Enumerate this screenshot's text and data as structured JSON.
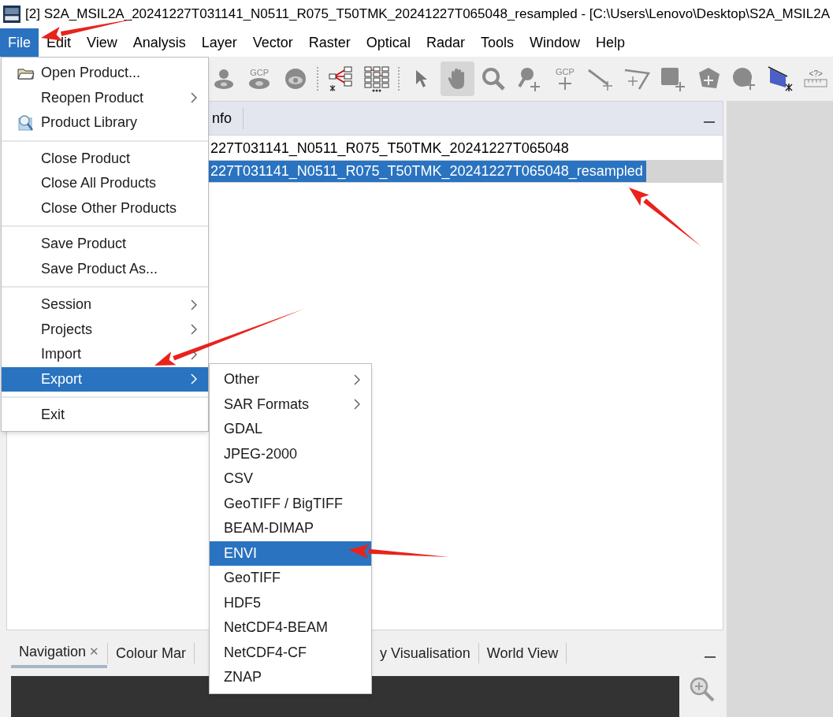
{
  "window": {
    "title": "[2] S2A_MSIL2A_20241227T031141_N0511_R075_T50TMK_20241227T065048_resampled - [C:\\Users\\Lenovo\\Desktop\\S2A_MSIL2A"
  },
  "menubar": [
    {
      "label": "File",
      "selected": true
    },
    {
      "label": "Edit",
      "selected": false
    },
    {
      "label": "View",
      "selected": false
    },
    {
      "label": "Analysis",
      "selected": false
    },
    {
      "label": "Layer",
      "selected": false
    },
    {
      "label": "Vector",
      "selected": false
    },
    {
      "label": "Raster",
      "selected": false
    },
    {
      "label": "Optical",
      "selected": false
    },
    {
      "label": "Radar",
      "selected": false
    },
    {
      "label": "Tools",
      "selected": false
    },
    {
      "label": "Window",
      "selected": false
    },
    {
      "label": "Help",
      "selected": false
    }
  ],
  "toolbar": [
    {
      "kind": "person-eye",
      "selected": false
    },
    {
      "kind": "gcp-eye",
      "label": "GCP",
      "selected": false
    },
    {
      "kind": "eye-ball",
      "selected": false
    },
    {
      "kind": "separator"
    },
    {
      "kind": "tree",
      "selected": false
    },
    {
      "kind": "grid",
      "selected": false
    },
    {
      "kind": "separator"
    },
    {
      "kind": "pointer",
      "selected": false
    },
    {
      "kind": "hand",
      "selected": true
    },
    {
      "kind": "zoom",
      "selected": false
    },
    {
      "kind": "pin-plus",
      "selected": false
    },
    {
      "kind": "gcp-plus",
      "label": "GCP",
      "selected": false
    },
    {
      "kind": "line",
      "selected": false
    },
    {
      "kind": "polyline",
      "selected": false
    },
    {
      "kind": "square-plus",
      "selected": false
    },
    {
      "kind": "shape-plus",
      "selected": false
    },
    {
      "kind": "circle-plus",
      "selected": false
    },
    {
      "kind": "select",
      "selected": false
    },
    {
      "kind": "ruler",
      "label": "<?>",
      "selected": false
    }
  ],
  "product_panel": {
    "tab": "nfo",
    "rows": [
      {
        "text": "227T031141_N0511_R075_T50TMK_20241227T065048",
        "selected": false
      },
      {
        "text": "227T031141_N0511_R075_T50TMK_20241227T065048_resampled",
        "selected": true
      }
    ]
  },
  "bottom_tabs": [
    {
      "label": "Navigation",
      "close": "✕",
      "selected": true
    },
    {
      "label": "Colour Mar",
      "selected": false
    },
    {
      "label": "y Visualisation",
      "selected": false
    },
    {
      "label": "World View",
      "selected": false
    }
  ],
  "file_menu": [
    [
      {
        "label": "Open Product...",
        "kind": "folder",
        "submenu": false,
        "selected": false
      },
      {
        "label": "Reopen Product",
        "submenu": true,
        "selected": false
      },
      {
        "label": "Product Library",
        "kind": "library",
        "submenu": false,
        "selected": false
      }
    ],
    [
      {
        "label": "Close Product",
        "submenu": false,
        "selected": false
      },
      {
        "label": "Close All Products",
        "submenu": false,
        "selected": false
      },
      {
        "label": "Close Other Products",
        "submenu": false,
        "selected": false
      }
    ],
    [
      {
        "label": "Save Product",
        "submenu": false,
        "selected": false
      },
      {
        "label": "Save Product As...",
        "submenu": false,
        "selected": false
      }
    ],
    [
      {
        "label": "Session",
        "submenu": true,
        "selected": false
      },
      {
        "label": "Projects",
        "submenu": true,
        "selected": false
      },
      {
        "label": "Import",
        "submenu": true,
        "selected": false
      },
      {
        "label": "Export",
        "submenu": true,
        "selected": true
      }
    ],
    [
      {
        "label": "Exit",
        "submenu": false,
        "selected": false
      }
    ]
  ],
  "export_menu": [
    {
      "label": "Other",
      "submenu": true,
      "selected": false
    },
    {
      "label": "SAR Formats",
      "submenu": true,
      "selected": false
    },
    {
      "label": "GDAL",
      "submenu": false,
      "selected": false
    },
    {
      "label": "JPEG-2000",
      "submenu": false,
      "selected": false
    },
    {
      "label": "CSV",
      "submenu": false,
      "selected": false
    },
    {
      "label": "GeoTIFF / BigTIFF",
      "submenu": false,
      "selected": false
    },
    {
      "label": "BEAM-DIMAP",
      "submenu": false,
      "selected": false
    },
    {
      "label": "ENVI",
      "submenu": false,
      "selected": true
    },
    {
      "label": "GeoTIFF",
      "submenu": false,
      "selected": false
    },
    {
      "label": "HDF5",
      "submenu": false,
      "selected": false
    },
    {
      "label": "NetCDF4-BEAM",
      "submenu": false,
      "selected": false
    },
    {
      "label": "NetCDF4-CF",
      "submenu": false,
      "selected": false
    },
    {
      "label": "ZNAP",
      "submenu": false,
      "selected": false
    }
  ]
}
